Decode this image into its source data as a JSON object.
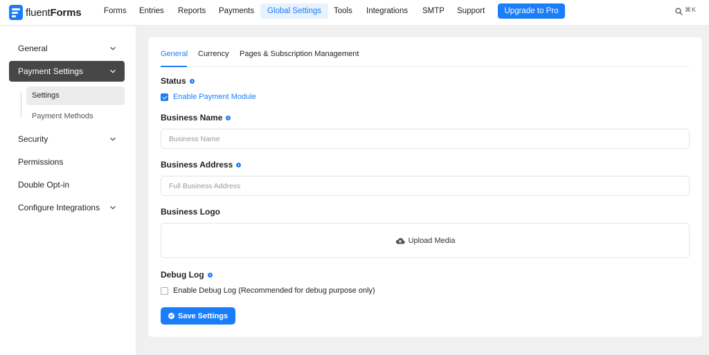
{
  "brand": {
    "name_light": "fluent",
    "name_bold": "Forms",
    "logo_icon": "fluentforms-logo-icon",
    "accent": "#1a7efb"
  },
  "topnav": {
    "items": [
      {
        "label": "Forms"
      },
      {
        "label": "Entries"
      },
      {
        "label": "Reports"
      },
      {
        "label": "Payments"
      },
      {
        "label": "Global Settings",
        "active": true
      },
      {
        "label": "Tools"
      },
      {
        "label": "Integrations"
      },
      {
        "label": "SMTP"
      },
      {
        "label": "Support"
      }
    ],
    "upgrade_label": "Upgrade to Pro",
    "search_icon": "search-icon",
    "shortcut": "⌘K"
  },
  "sidebar": {
    "items": [
      {
        "label": "General",
        "chevron": true
      },
      {
        "label": "Payment Settings",
        "chevron": true,
        "active": true
      },
      {
        "label": "Security",
        "chevron": true
      },
      {
        "label": "Permissions"
      },
      {
        "label": "Double Opt-in"
      },
      {
        "label": "Configure Integrations",
        "chevron": true
      }
    ],
    "subitems": [
      {
        "label": "Settings",
        "active": true
      },
      {
        "label": "Payment Methods"
      }
    ]
  },
  "tabs": [
    {
      "label": "General",
      "active": true
    },
    {
      "label": "Currency"
    },
    {
      "label": "Pages & Subscription Management"
    }
  ],
  "form": {
    "status_label": "Status",
    "enable_payment_label": "Enable Payment Module",
    "enable_payment_checked": true,
    "business_name_label": "Business Name",
    "business_name_placeholder": "Business Name",
    "business_name_value": "",
    "business_address_label": "Business Address",
    "business_address_placeholder": "Full Business Address",
    "business_address_value": "",
    "business_logo_label": "Business Logo",
    "upload_label": "Upload Media",
    "debug_log_label": "Debug Log",
    "enable_debug_label": "Enable Debug Log (Recommended for debug purpose only)",
    "enable_debug_checked": false,
    "save_label": "Save Settings"
  }
}
